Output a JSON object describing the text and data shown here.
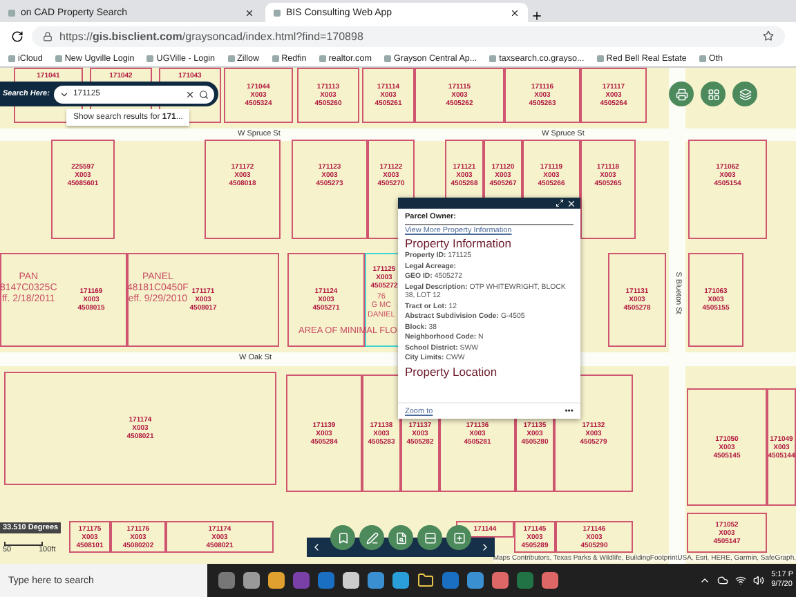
{
  "browser": {
    "tabs": [
      {
        "title": "on CAD Property Search",
        "selected": false
      },
      {
        "title": "BIS Consulting Web App",
        "selected": true
      }
    ],
    "url": "https://**gis.bisclient.com**/graysoncad/index.html?find=170898",
    "bookmarks": [
      "iCloud",
      "New Ugville Login",
      "UGVille - Login",
      "Zillow",
      "Redfin",
      "realtor.com",
      "Grayson Central Ap...",
      "taxsearch.co.grayso...",
      "Red Bell Real Estate",
      "Oth"
    ]
  },
  "search": {
    "label": "Search Here:",
    "value": "171125",
    "suggestion": "Show search results for **171**..."
  },
  "map": {
    "streets": [
      {
        "name": "W Spruce St",
        "kind": "horizontal"
      },
      {
        "name": "W Spruce St",
        "kind": "horizontal"
      },
      {
        "name": "W Oak St",
        "kind": "horizontal"
      },
      {
        "name": "S Blueton St",
        "kind": "vertical"
      }
    ],
    "parcels": [
      {
        "lines": [
          "171041"
        ],
        "selected": false
      },
      {
        "lines": [
          "171042"
        ],
        "selected": false
      },
      {
        "lines": [
          "171043"
        ],
        "selected": false
      },
      {
        "lines": [
          "171044",
          "X003",
          "4505324"
        ],
        "selected": false
      },
      {
        "lines": [
          "171113",
          "X003",
          "4505260"
        ],
        "selected": false
      },
      {
        "lines": [
          "171114",
          "X003",
          "4505261"
        ],
        "selected": false
      },
      {
        "lines": [
          "171115",
          "X003",
          "4505262"
        ],
        "selected": false
      },
      {
        "lines": [
          "171116",
          "X003",
          "4505263"
        ],
        "selected": false
      },
      {
        "lines": [
          "171117",
          "X003",
          "4505264"
        ],
        "selected": false
      },
      {
        "lines": [
          "225597",
          "X003",
          "45085601"
        ],
        "selected": false
      },
      {
        "lines": [
          "171172",
          "X003",
          "4508018"
        ],
        "selected": false
      },
      {
        "lines": [
          "171123",
          "X003",
          "4505273"
        ],
        "selected": false
      },
      {
        "lines": [
          "171122",
          "X003",
          "4505270"
        ],
        "selected": false
      },
      {
        "lines": [
          "171121",
          "X003",
          "4505268"
        ],
        "selected": false
      },
      {
        "lines": [
          "171120",
          "X003",
          "4505267"
        ],
        "selected": false
      },
      {
        "lines": [
          "171119",
          "X003",
          "4505266"
        ],
        "selected": false
      },
      {
        "lines": [
          "171118",
          "X003",
          "4505265"
        ],
        "selected": false
      },
      {
        "lines": [
          "171062",
          "X003",
          "4505154"
        ],
        "selected": false
      },
      {
        "lines": [
          "171169",
          "X003",
          "4508015"
        ],
        "selected": false
      },
      {
        "lines": [
          "171171",
          "X003",
          "4508017"
        ],
        "selected": false
      },
      {
        "lines": [
          "171124",
          "X003",
          "4505271"
        ],
        "selected": false
      },
      {
        "lines": [
          "171125",
          "X003",
          "4505272"
        ],
        "selected": true
      },
      {
        "lines": [
          "171131",
          "X003",
          "4505278"
        ],
        "selected": false
      },
      {
        "lines": [
          "171063",
          "X003",
          "4505155"
        ],
        "selected": false
      },
      {
        "lines": [
          "171174",
          "X003",
          "4508021"
        ],
        "selected": false
      },
      {
        "lines": [
          "171139",
          "X003",
          "4505284"
        ],
        "selected": false
      },
      {
        "lines": [
          "171138",
          "X003",
          "4505283"
        ],
        "selected": false
      },
      {
        "lines": [
          "171137",
          "X003",
          "4505282"
        ],
        "selected": false
      },
      {
        "lines": [
          "171136",
          "X003",
          "4505281"
        ],
        "selected": false
      },
      {
        "lines": [
          "171135",
          "X003",
          "4505280"
        ],
        "selected": false
      },
      {
        "lines": [
          "171132",
          "X003",
          "4505279"
        ],
        "selected": false
      },
      {
        "lines": [
          "171050",
          "X003",
          "4505145"
        ],
        "selected": false
      },
      {
        "lines": [
          "171049",
          "X003",
          "4505144"
        ],
        "selected": false
      },
      {
        "lines": [
          "171175",
          "X003",
          "4508101"
        ],
        "selected": false
      },
      {
        "lines": [
          "171176",
          "X003",
          "45080202"
        ],
        "selected": false
      },
      {
        "lines": [
          "171174",
          "X003",
          "4508021"
        ],
        "selected": false
      },
      {
        "lines": [
          "171144"
        ],
        "selected": false
      },
      {
        "lines": [
          "171145",
          "X003",
          "4505289"
        ],
        "selected": false
      },
      {
        "lines": [
          "171146",
          "X003",
          "4505290"
        ],
        "selected": false
      },
      {
        "lines": [
          "171052",
          "X003",
          "4505147"
        ],
        "selected": false
      }
    ],
    "flood_labels": [
      {
        "lines": [
          "PAN",
          "8147C0325C",
          "ff. 2/18/2011"
        ]
      },
      {
        "lines": [
          "PANEL",
          "48181C0450F",
          "eff. 9/29/2010"
        ]
      },
      {
        "lines": [
          "76",
          "G MC",
          "DANIEL"
        ]
      },
      {
        "lines": [
          "AREA OF MINIMAL FLO"
        ]
      }
    ],
    "scale": {
      "reading": "33.510 Degrees",
      "ticks": [
        "50",
        "100ft"
      ]
    },
    "attribution": "Maps Contributors, Texas Parks & Wildlife, BuildingFootprintUSA, Esri, HERE, Garmin, SafeGraph,"
  },
  "popup": {
    "owner_label": "Parcel Owner:",
    "link": "View More Property Information",
    "heading": "Property Information",
    "fields": [
      "**Property ID:** 171125",
      "**Legal Acreage:**",
      "**GEO ID:** 4505272",
      "**Legal Description:** OTP WHITEWRIGHT, BLOCK 38, LOT 12",
      "**Tract or Lot:** 12",
      "**Abstract Subdivision Code:** G-4505",
      "**Block:** 38",
      "**Neighborhood Code:** N",
      "**School District:** SWW",
      "**City Limits:** CWW"
    ],
    "next_heading": "Property Location",
    "zoom_link": "Zoom to",
    "more": "•••"
  },
  "taskbar": {
    "search_placeholder": "Type here to search",
    "apps": [
      {
        "kind": "cortana"
      },
      {
        "kind": "taskview"
      },
      {
        "kind": "chrome"
      },
      {
        "kind": "onenote"
      },
      {
        "kind": "outlook"
      },
      {
        "kind": "store"
      },
      {
        "kind": "photos"
      },
      {
        "kind": "edge"
      },
      {
        "kind": "folder"
      },
      {
        "kind": "outlook"
      },
      {
        "kind": "photos"
      },
      {
        "kind": "paint"
      },
      {
        "kind": "excel"
      },
      {
        "kind": "paint"
      }
    ],
    "time": "5:17 P",
    "date": "9/7/20"
  }
}
